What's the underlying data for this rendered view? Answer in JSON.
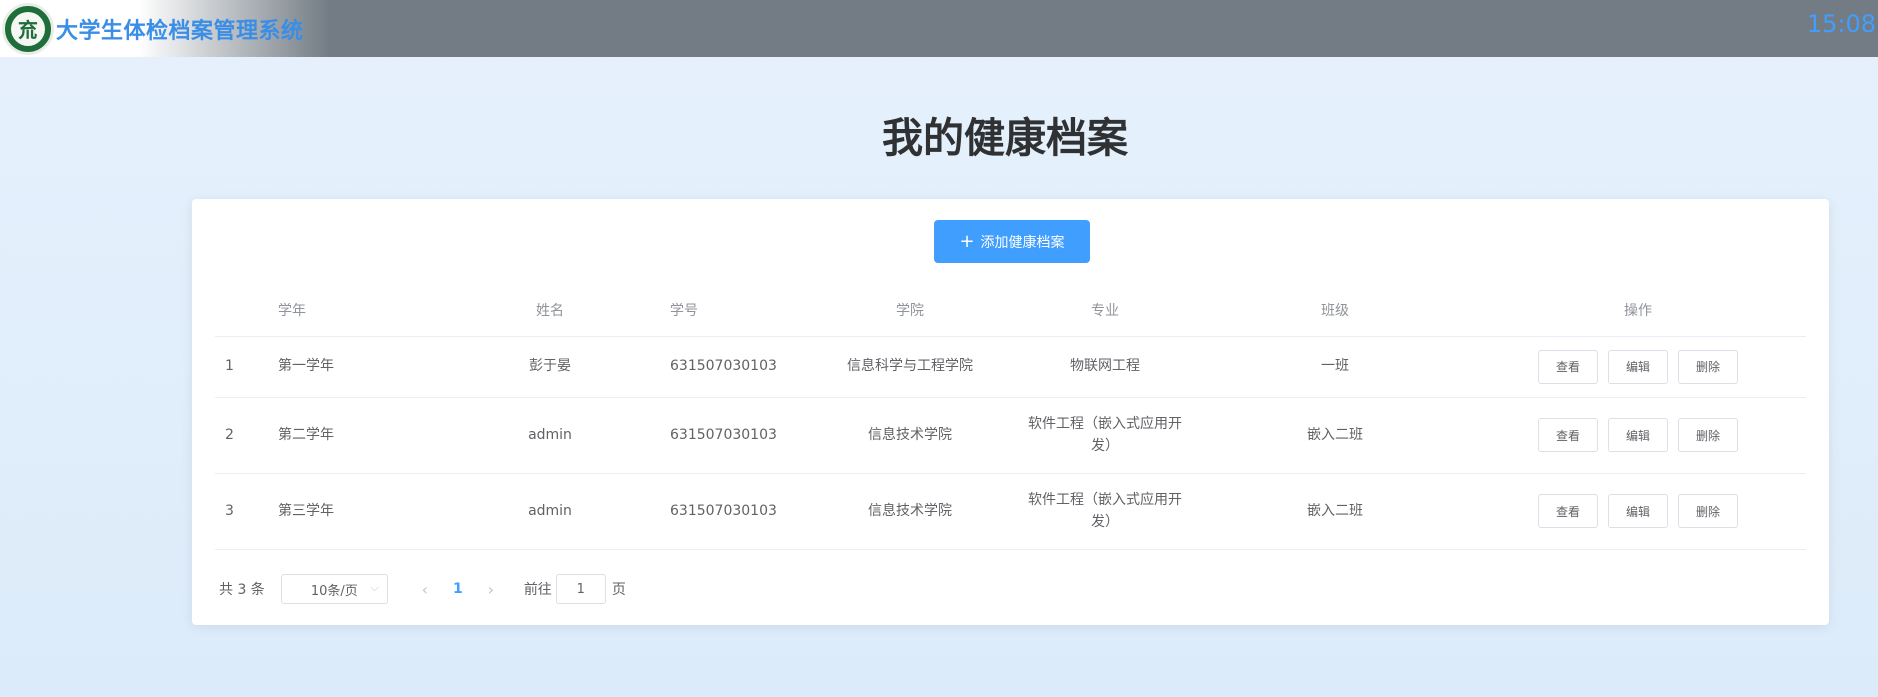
{
  "header": {
    "logo_icon": "university-seal-icon",
    "logo_glyph": "㐬",
    "app_title": "大学生体检档案管理系统",
    "clock": "15:08"
  },
  "page_title": "我的健康档案",
  "toolbar": {
    "add_icon": "plus-icon",
    "add_glyph": "+",
    "add_label": "添加健康档案"
  },
  "table": {
    "columns": [
      "",
      "学年",
      "姓名",
      "学号",
      "学院",
      "专业",
      "班级",
      "操作"
    ],
    "rows": [
      {
        "index": "1",
        "year": "第一学年",
        "name": "彭于晏",
        "student_id": "631507030103",
        "college": "信息科学与工程学院",
        "major": "物联网工程",
        "class": "一班"
      },
      {
        "index": "2",
        "year": "第二学年",
        "name": "admin",
        "student_id": "631507030103",
        "college": "信息技术学院",
        "major": "软件工程（嵌入式应用开发）",
        "class": "嵌入二班"
      },
      {
        "index": "3",
        "year": "第三学年",
        "name": "admin",
        "student_id": "631507030103",
        "college": "信息技术学院",
        "major": "软件工程（嵌入式应用开发）",
        "class": "嵌入二班"
      }
    ],
    "actions": {
      "view": "查看",
      "edit": "编辑",
      "delete": "删除"
    }
  },
  "pagination": {
    "total": "共 3 条",
    "page_size": "10条/页",
    "current_page": "1",
    "goto_label": "前往",
    "goto_value": "1",
    "goto_suffix": "页",
    "prev_glyph": "‹",
    "next_glyph": "›",
    "caret_glyph": "⌵"
  },
  "colors": {
    "primary": "#409eff",
    "header_bg": "#737c84",
    "page_bg": "#e6f1fc"
  }
}
